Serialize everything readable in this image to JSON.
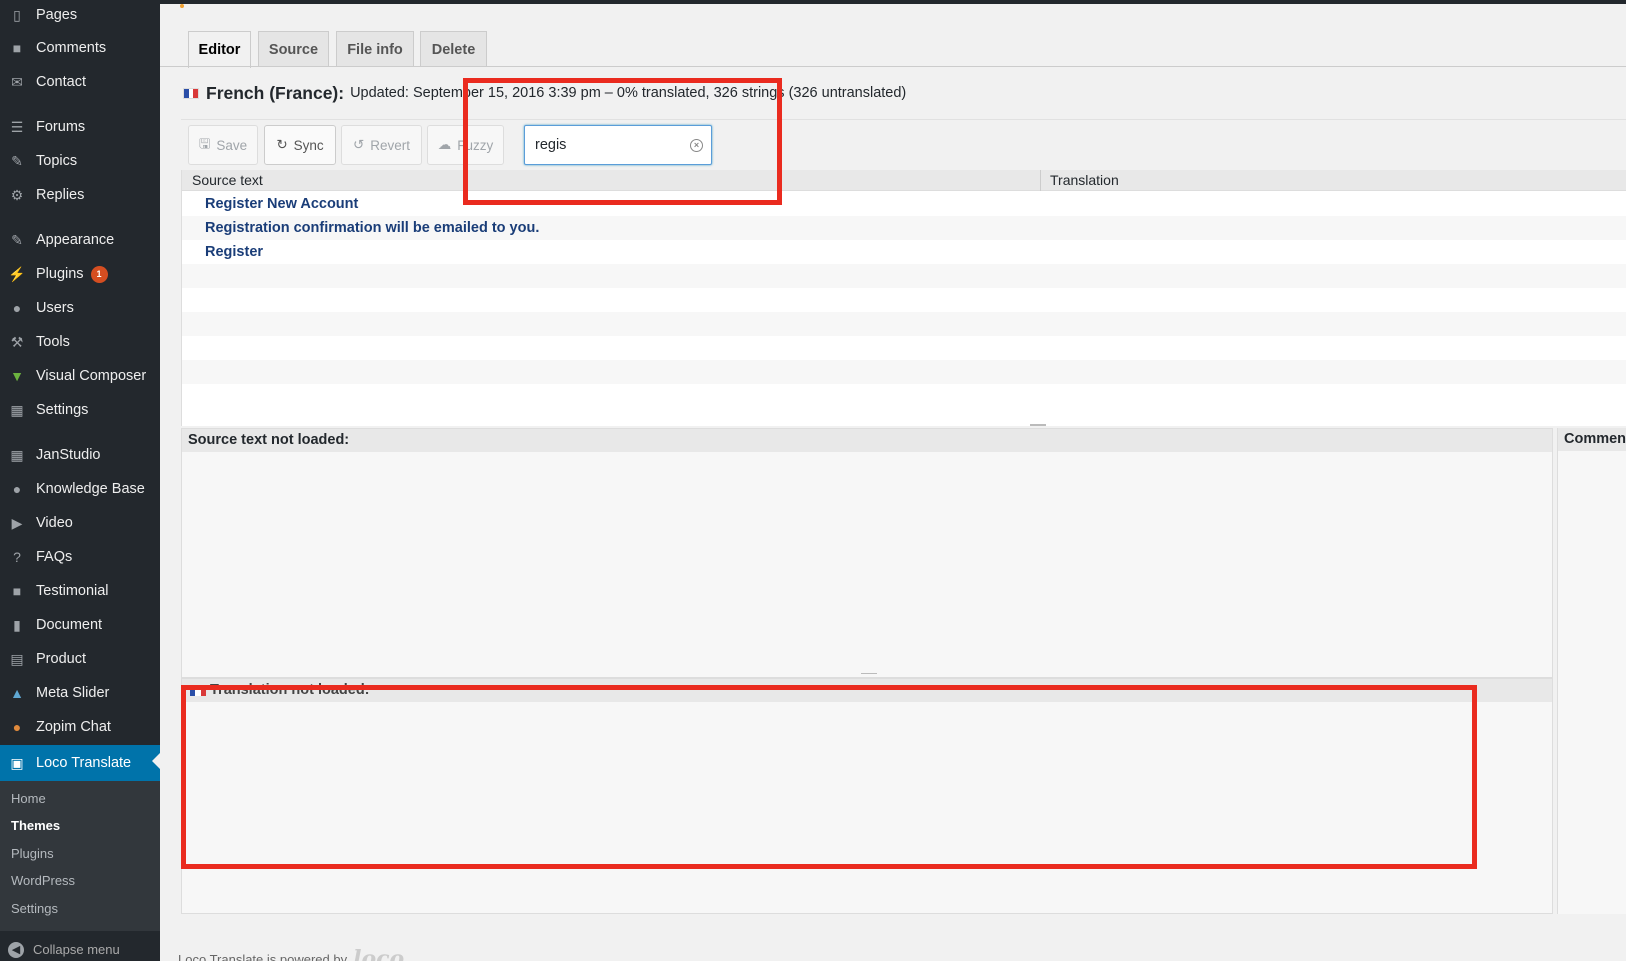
{
  "sidebar": {
    "items": [
      {
        "label": "Pages",
        "icon": "pages-icon"
      },
      {
        "label": "Comments",
        "icon": "comments-icon"
      },
      {
        "label": "Contact",
        "icon": "mail-icon"
      },
      {
        "label": "Forums",
        "icon": "forums-icon"
      },
      {
        "label": "Topics",
        "icon": "topics-icon"
      },
      {
        "label": "Replies",
        "icon": "replies-icon"
      },
      {
        "label": "Appearance",
        "icon": "appearance-icon"
      },
      {
        "label": "Plugins",
        "icon": "plugins-icon",
        "badge": "1"
      },
      {
        "label": "Users",
        "icon": "users-icon"
      },
      {
        "label": "Tools",
        "icon": "tools-icon"
      },
      {
        "label": "Visual Composer",
        "icon": "visual-composer-icon"
      },
      {
        "label": "Settings",
        "icon": "settings-icon"
      },
      {
        "label": "JanStudio",
        "icon": "janstudio-icon"
      },
      {
        "label": "Knowledge Base",
        "icon": "lightbulb-icon"
      },
      {
        "label": "Video",
        "icon": "video-icon"
      },
      {
        "label": "FAQs",
        "icon": "question-icon"
      },
      {
        "label": "Testimonial",
        "icon": "testimonial-icon"
      },
      {
        "label": "Document",
        "icon": "document-icon"
      },
      {
        "label": "Product",
        "icon": "product-icon"
      },
      {
        "label": "Meta Slider",
        "icon": "meta-slider-icon"
      },
      {
        "label": "Zopim Chat",
        "icon": "chat-icon"
      },
      {
        "label": "Loco Translate",
        "icon": "translate-icon",
        "active": true
      }
    ],
    "submenu": [
      "Home",
      "Themes",
      "Plugins",
      "WordPress",
      "Settings"
    ],
    "submenu_current": "Themes",
    "collapse_label": "Collapse menu"
  },
  "tabs": [
    {
      "label": "Editor",
      "active": true
    },
    {
      "label": "Source"
    },
    {
      "label": "File info"
    },
    {
      "label": "Delete"
    }
  ],
  "header": {
    "language": "French (France):",
    "meta": "Updated: September 15, 2016 3:39 pm – 0% translated, 326 strings (326 untranslated)"
  },
  "toolbar": {
    "save_label": "Save",
    "sync_label": "Sync",
    "revert_label": "Revert",
    "fuzzy_label": "Fuzzy",
    "search_value": "regis"
  },
  "grid": {
    "columns": [
      "Source text",
      "Translation"
    ],
    "rows": [
      "Register New Account",
      "Registration confirmation will be emailed to you.",
      "Register"
    ]
  },
  "panes": {
    "source_title": "Source text not loaded:",
    "translation_title": "Translation not loaded:",
    "comments_title": "Comments"
  },
  "footer": {
    "text": "Loco Translate is powered by",
    "logo": "loco"
  },
  "colors": {
    "sidebar_bg": "#23282d",
    "active_menu": "#0073aa",
    "annotation_red": "#ea2b1f",
    "link_blue": "#1a3d78"
  }
}
